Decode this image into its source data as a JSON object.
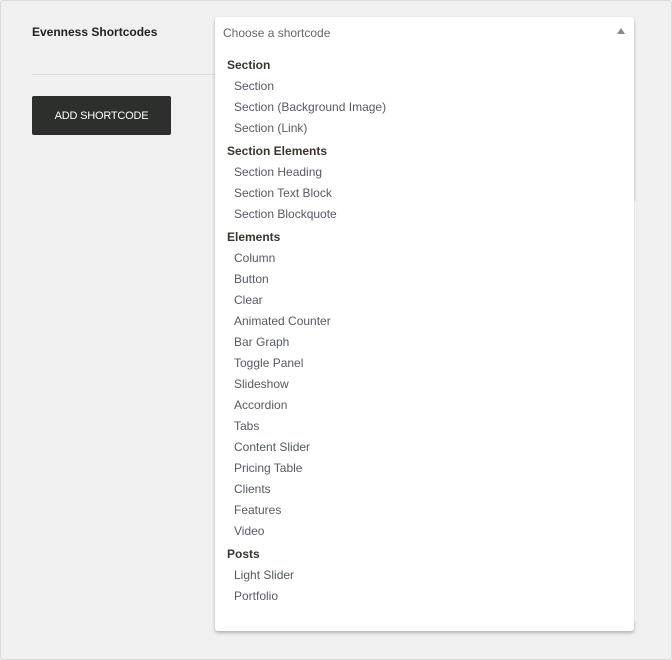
{
  "form": {
    "label": "Evenness Shortcodes",
    "add_button": "ADD SHORTCODE"
  },
  "select": {
    "placeholder": "Choose a shortcode",
    "caret_icon": "triangle-up",
    "groups": [
      {
        "label": "Section",
        "options": [
          "Section",
          "Section (Background Image)",
          "Section (Link)"
        ]
      },
      {
        "label": "Section Elements",
        "options": [
          "Section Heading",
          "Section Text Block",
          "Section Blockquote"
        ]
      },
      {
        "label": "Elements",
        "options": [
          "Column",
          "Button",
          "Clear",
          "Animated Counter",
          "Bar Graph",
          "Toggle Panel",
          "Slideshow",
          "Accordion",
          "Tabs",
          "Content Slider",
          "Pricing Table",
          "Clients",
          "Features",
          "Video"
        ]
      },
      {
        "label": "Posts",
        "options": [
          "Light Slider",
          "Portfolio"
        ]
      }
    ]
  },
  "colors": {
    "button_bg": "#2d2f2c",
    "page_bg": "#f0f0f0",
    "group_label": "#3b3530",
    "option_text": "#555a64"
  }
}
